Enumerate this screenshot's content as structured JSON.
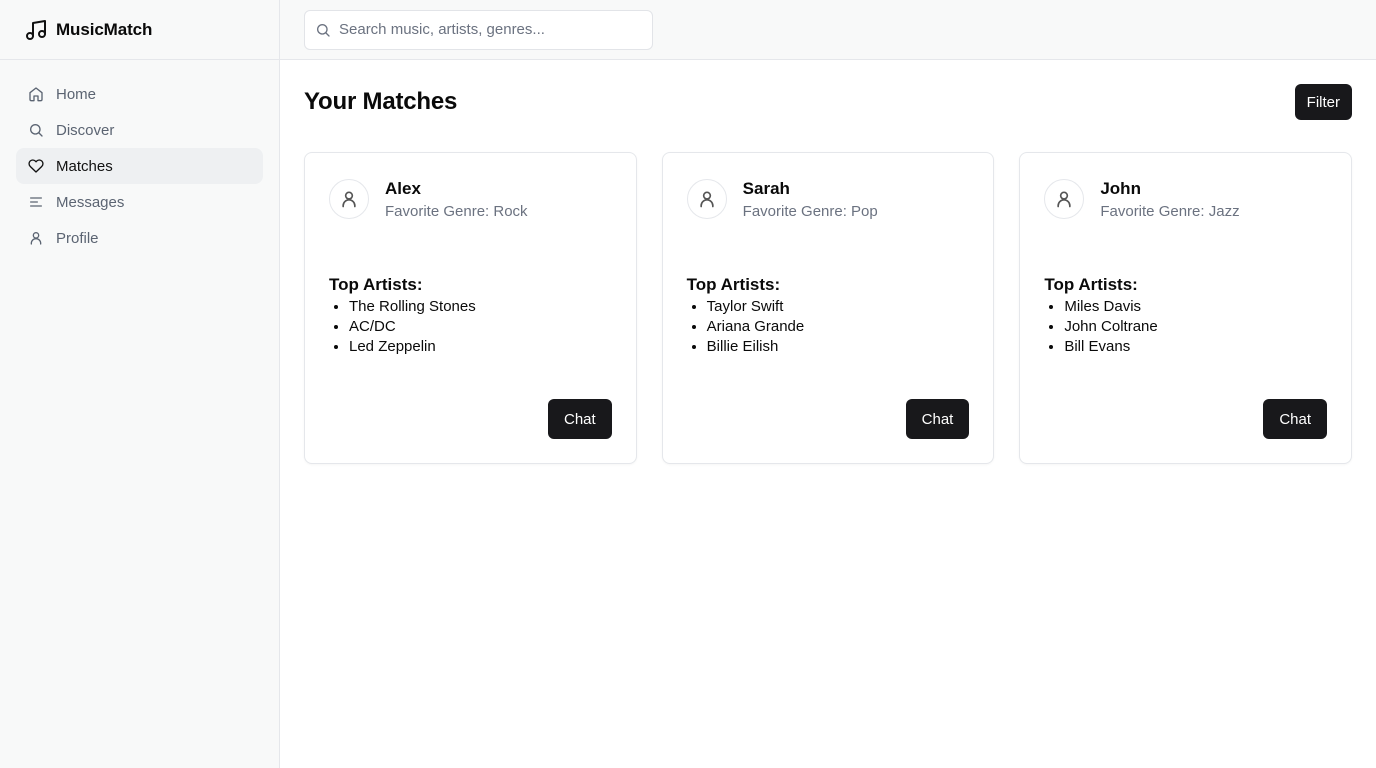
{
  "app": {
    "name": "MusicMatch"
  },
  "nav": {
    "items": [
      {
        "label": "Home",
        "icon": "home-icon",
        "active": false
      },
      {
        "label": "Discover",
        "icon": "search-icon",
        "active": false
      },
      {
        "label": "Matches",
        "icon": "heart-icon",
        "active": true
      },
      {
        "label": "Messages",
        "icon": "lines-icon",
        "active": false
      },
      {
        "label": "Profile",
        "icon": "user-icon",
        "active": false
      }
    ]
  },
  "search": {
    "placeholder": "Search music, artists, genres...",
    "value": ""
  },
  "main": {
    "title": "Your Matches",
    "filter_label": "Filter",
    "artists_heading": "Top Artists:",
    "chat_label": "Chat",
    "matches": [
      {
        "name": "Alex",
        "genre": "Favorite Genre: Rock",
        "artists": [
          "The Rolling Stones",
          "AC/DC",
          "Led Zeppelin"
        ]
      },
      {
        "name": "Sarah",
        "genre": "Favorite Genre: Pop",
        "artists": [
          "Taylor Swift",
          "Ariana Grande",
          "Billie Eilish"
        ]
      },
      {
        "name": "John",
        "genre": "Favorite Genre: Jazz",
        "artists": [
          "Miles Davis",
          "John Coltrane",
          "Bill Evans"
        ]
      }
    ]
  },
  "colors": {
    "accent": "#18181b",
    "sidebar_bg": "#f8f9f9",
    "muted_text": "#6b7280"
  }
}
